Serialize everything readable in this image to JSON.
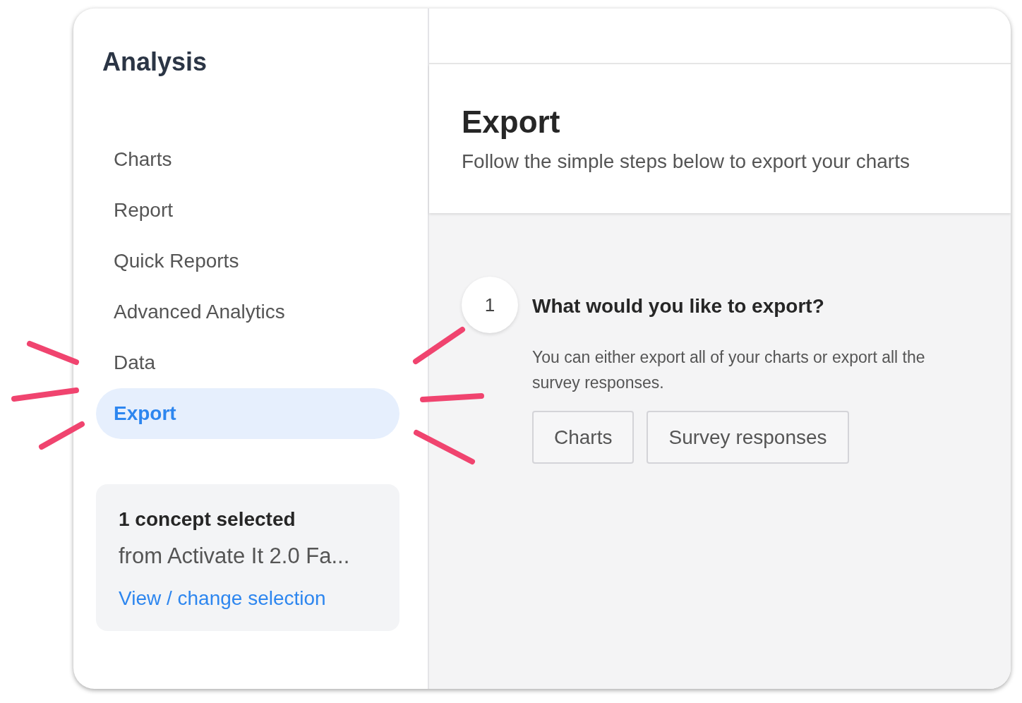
{
  "sidebar": {
    "title": "Analysis",
    "items": [
      {
        "label": "Charts",
        "selected": false
      },
      {
        "label": "Report",
        "selected": false
      },
      {
        "label": "Quick Reports",
        "selected": false
      },
      {
        "label": "Advanced Analytics",
        "selected": false
      },
      {
        "label": "Data",
        "selected": false
      },
      {
        "label": "Export",
        "selected": true
      }
    ],
    "selection_card": {
      "heading": "1 concept selected",
      "source": "from Activate It 2.0 Fa...",
      "link": "View / change selection"
    }
  },
  "main": {
    "title": "Export",
    "subtitle": "Follow the simple steps below to export your charts",
    "step": {
      "number": "1",
      "question": "What would you like to export?",
      "description": "You can either export all of your charts or export all the survey responses.",
      "buttons": [
        "Charts",
        "Survey responses"
      ]
    }
  }
}
